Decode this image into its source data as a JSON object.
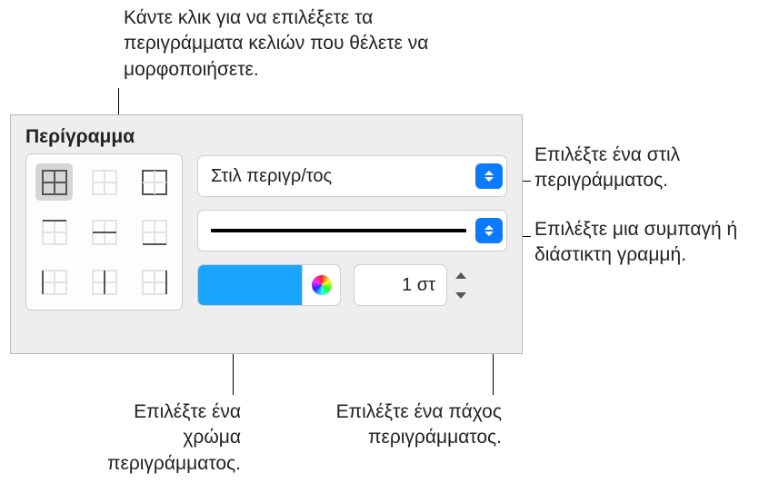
{
  "callouts": {
    "top": "Κάντε κλικ για να επιλέξετε τα περιγράμματα κελιών που θέλετε να μορφοποιήσετε.",
    "style": "Επιλέξτε ένα στιλ περιγράμματος.",
    "line": "Επιλέξτε μια συμπαγή ή διάστικτη γραμμή.",
    "color": "Επιλέξτε ένα χρώμα περιγράμματος.",
    "width": "Επιλέξτε ένα πάχος περιγράμματος."
  },
  "panel": {
    "title": "Περίγραμμα",
    "grid_picker": {
      "cells": [
        {
          "name": "all-borders",
          "emph": {
            "outer": true,
            "innerV": true,
            "innerH": true
          },
          "selected": true
        },
        {
          "name": "no-borders",
          "emph": {}
        },
        {
          "name": "outer-borders",
          "emph": {
            "outer": true
          }
        },
        {
          "name": "top-border",
          "emph": {
            "top": true
          }
        },
        {
          "name": "inner-horizontal",
          "emph": {
            "innerH": true
          }
        },
        {
          "name": "bottom-border",
          "emph": {
            "bottom": true
          }
        },
        {
          "name": "left-border",
          "emph": {
            "left": true
          }
        },
        {
          "name": "inner-vertical",
          "emph": {
            "innerV": true
          }
        },
        {
          "name": "right-border",
          "emph": {
            "right": true
          }
        }
      ]
    },
    "style_popup": {
      "label": "Στιλ περιγρ/τος"
    },
    "line_popup": {
      "preview": "solid"
    },
    "color": {
      "swatch_hex": "#1aa4ff"
    },
    "width": {
      "value": "1 στ"
    }
  }
}
